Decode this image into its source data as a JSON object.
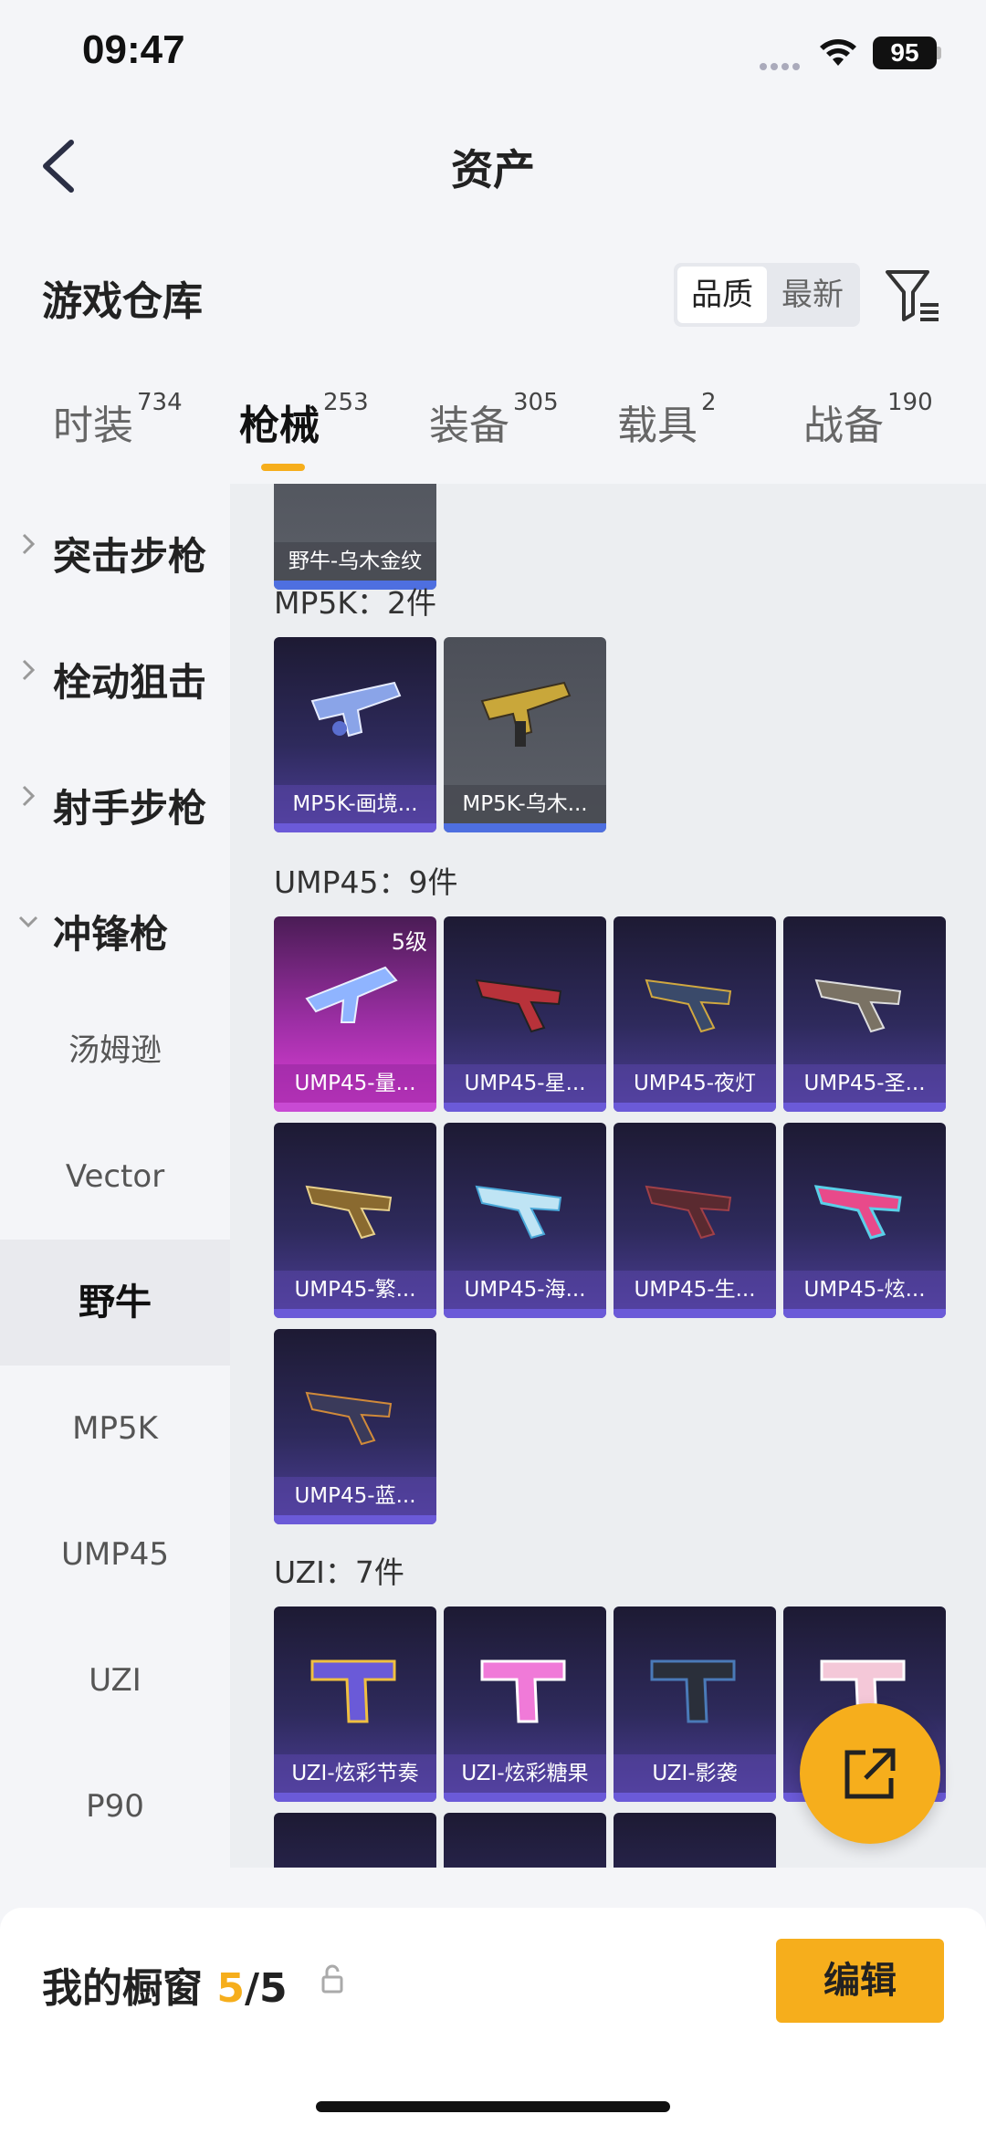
{
  "status": {
    "time": "09:47",
    "battery": "95"
  },
  "nav": {
    "title": "资产"
  },
  "warehouse": {
    "title": "游戏仓库"
  },
  "sort": {
    "options": [
      "品质",
      "最新"
    ],
    "selected": "品质"
  },
  "tabs": [
    {
      "label": "时装",
      "count": "734"
    },
    {
      "label": "枪械",
      "count": "253"
    },
    {
      "label": "装备",
      "count": "305"
    },
    {
      "label": "载具",
      "count": "2"
    },
    {
      "label": "战备",
      "count": "190"
    }
  ],
  "active_tab": "枪械",
  "sidebar": {
    "categories": [
      "突击步枪",
      "栓动狙击",
      "射手步枪",
      "冲锋枪"
    ],
    "subs": [
      "汤姆逊",
      "Vector",
      "野牛",
      "MP5K",
      "UMP45",
      "UZI",
      "P90"
    ],
    "active_sub": "野牛"
  },
  "content": {
    "top_card": "野牛-乌木金纹",
    "sections": [
      {
        "title": "MP5K：2件",
        "items": [
          "MP5K-画境...",
          "MP5K-乌木..."
        ]
      },
      {
        "title": "UMP45：9件",
        "items": [
          "UMP45-量...",
          "UMP45-星...",
          "UMP45-夜灯",
          "UMP45-圣...",
          "UMP45-繁...",
          "UMP45-海...",
          "UMP45-生...",
          "UMP45-炫...",
          "UMP45-蓝..."
        ],
        "level_badge": "5级"
      },
      {
        "title": "UZI：7件",
        "items": [
          "UZI-炫彩节奏",
          "UZI-炫彩糖果",
          "UZI-影袭"
        ]
      }
    ]
  },
  "showcase": {
    "label": "我的橱窗",
    "current": "5",
    "total": "/5"
  },
  "edit_button": "编辑",
  "colors": {
    "accent": "#f6ae1c",
    "card_purple": "#2e2a5c",
    "card_pink": "#e03fd9"
  }
}
